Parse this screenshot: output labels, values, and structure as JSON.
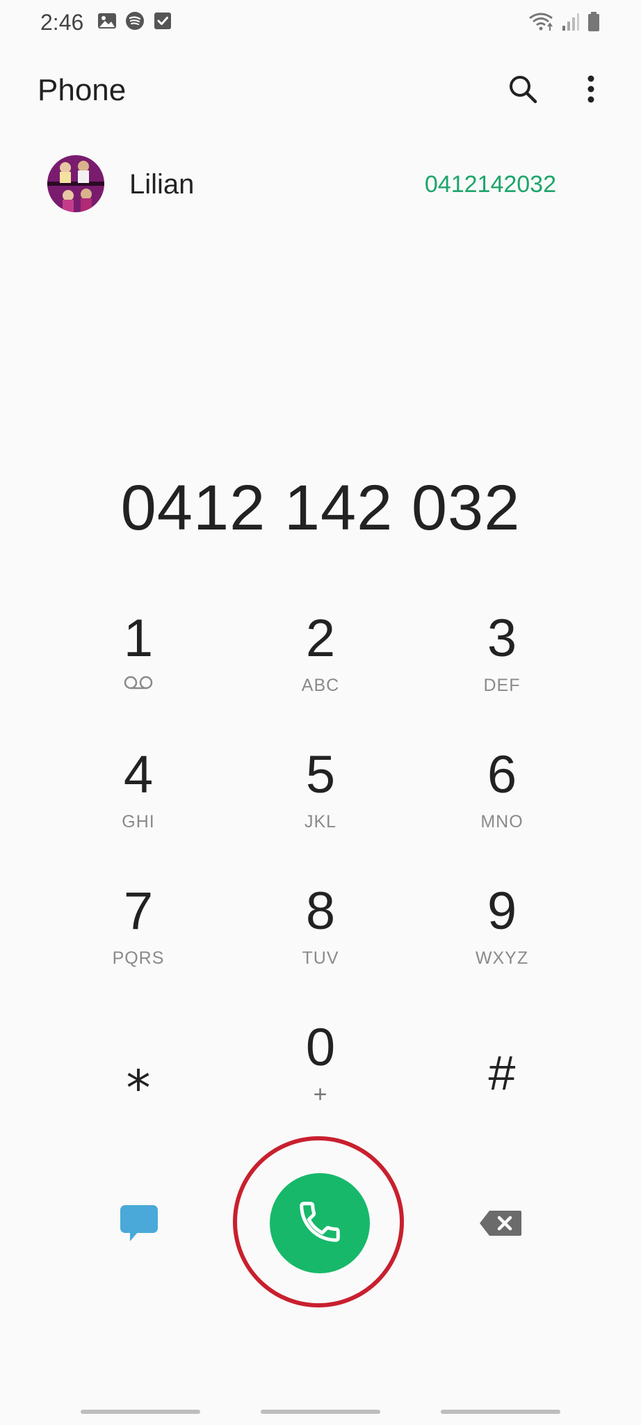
{
  "status_bar": {
    "time": "2:46",
    "left_icons": [
      "gallery-icon",
      "spotify-icon",
      "checkbox-icon"
    ],
    "right_icons": [
      "wifi-icon",
      "signal-icon",
      "battery-icon"
    ]
  },
  "header": {
    "title": "Phone",
    "actions": [
      "search-icon",
      "more-options-icon"
    ]
  },
  "suggestion": {
    "name": "Lilian",
    "number": "0412142032"
  },
  "dialer": {
    "number": "0412 142 032",
    "keys": [
      {
        "digit": "1",
        "letters": ""
      },
      {
        "digit": "2",
        "letters": "ABC"
      },
      {
        "digit": "3",
        "letters": "DEF"
      },
      {
        "digit": "4",
        "letters": "GHI"
      },
      {
        "digit": "5",
        "letters": "JKL"
      },
      {
        "digit": "6",
        "letters": "MNO"
      },
      {
        "digit": "7",
        "letters": "PQRS"
      },
      {
        "digit": "8",
        "letters": "TUV"
      },
      {
        "digit": "9",
        "letters": "WXYZ"
      },
      {
        "digit": "⁎",
        "letters": ""
      },
      {
        "digit": "0",
        "letters": "+"
      },
      {
        "digit": "#",
        "letters": ""
      }
    ]
  },
  "colors": {
    "call": "#17b86a",
    "highlight": "#c8202e",
    "message": "#4aa9d8",
    "number_accent": "#1ea56b"
  }
}
